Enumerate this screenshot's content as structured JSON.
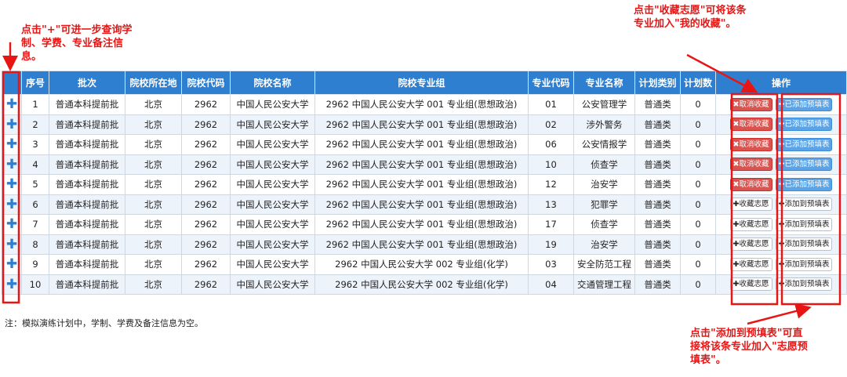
{
  "annotations": {
    "plus_note": "点击\"+\"可进一步查询学制、学费、专业备注信息。",
    "favorite_note": "点击\"收藏志愿\"可将该条专业加入\"我的收藏\"。",
    "preform_note": "点击\"添加到预填表\"可直接将该条专业加入\"志愿预填表\"。"
  },
  "table": {
    "headers": [
      "",
      "序号",
      "批次",
      "院校所在地",
      "院校代码",
      "院校名称",
      "院校专业组",
      "专业代码",
      "专业名称",
      "计划类别",
      "计划数",
      "操作"
    ],
    "rows": [
      {
        "plus": "✚",
        "no": "1",
        "batch": "普通本科提前批",
        "loc": "北京",
        "code": "2962",
        "school": "中国人民公安大学",
        "group": "2962 中国人民公安大学 001 专业组(思想政治)",
        "major_code": "01",
        "major": "公安管理学",
        "plan_type": "普通类",
        "plan_num": "0",
        "fav": "✖取消收藏",
        "pre": "✚已添加预填表",
        "fav_state": "on",
        "pre_state": "on"
      },
      {
        "plus": "✚",
        "no": "2",
        "batch": "普通本科提前批",
        "loc": "北京",
        "code": "2962",
        "school": "中国人民公安大学",
        "group": "2962 中国人民公安大学 001 专业组(思想政治)",
        "major_code": "02",
        "major": "涉外警务",
        "plan_type": "普通类",
        "plan_num": "0",
        "fav": "✖取消收藏",
        "pre": "✚已添加预填表",
        "fav_state": "on",
        "pre_state": "on"
      },
      {
        "plus": "✚",
        "no": "3",
        "batch": "普通本科提前批",
        "loc": "北京",
        "code": "2962",
        "school": "中国人民公安大学",
        "group": "2962 中国人民公安大学 001 专业组(思想政治)",
        "major_code": "06",
        "major": "公安情报学",
        "plan_type": "普通类",
        "plan_num": "0",
        "fav": "✖取消收藏",
        "pre": "✚已添加预填表",
        "fav_state": "on",
        "pre_state": "on"
      },
      {
        "plus": "✚",
        "no": "4",
        "batch": "普通本科提前批",
        "loc": "北京",
        "code": "2962",
        "school": "中国人民公安大学",
        "group": "2962 中国人民公安大学 001 专业组(思想政治)",
        "major_code": "10",
        "major": "侦查学",
        "plan_type": "普通类",
        "plan_num": "0",
        "fav": "✖取消收藏",
        "pre": "✚已添加预填表",
        "fav_state": "on",
        "pre_state": "on"
      },
      {
        "plus": "✚",
        "no": "5",
        "batch": "普通本科提前批",
        "loc": "北京",
        "code": "2962",
        "school": "中国人民公安大学",
        "group": "2962 中国人民公安大学 001 专业组(思想政治)",
        "major_code": "12",
        "major": "治安学",
        "plan_type": "普通类",
        "plan_num": "0",
        "fav": "✖取消收藏",
        "pre": "✚已添加预填表",
        "fav_state": "on",
        "pre_state": "on"
      },
      {
        "plus": "✚",
        "no": "6",
        "batch": "普通本科提前批",
        "loc": "北京",
        "code": "2962",
        "school": "中国人民公安大学",
        "group": "2962 中国人民公安大学 001 专业组(思想政治)",
        "major_code": "13",
        "major": "犯罪学",
        "plan_type": "普通类",
        "plan_num": "0",
        "fav": "✚收藏志愿",
        "pre": "✚添加到预填表",
        "fav_state": "off",
        "pre_state": "off"
      },
      {
        "plus": "✚",
        "no": "7",
        "batch": "普通本科提前批",
        "loc": "北京",
        "code": "2962",
        "school": "中国人民公安大学",
        "group": "2962 中国人民公安大学 001 专业组(思想政治)",
        "major_code": "17",
        "major": "侦查学",
        "plan_type": "普通类",
        "plan_num": "0",
        "fav": "✚收藏志愿",
        "pre": "✚添加到预填表",
        "fav_state": "off",
        "pre_state": "off"
      },
      {
        "plus": "✚",
        "no": "8",
        "batch": "普通本科提前批",
        "loc": "北京",
        "code": "2962",
        "school": "中国人民公安大学",
        "group": "2962 中国人民公安大学 001 专业组(思想政治)",
        "major_code": "19",
        "major": "治安学",
        "plan_type": "普通类",
        "plan_num": "0",
        "fav": "✚收藏志愿",
        "pre": "✚添加到预填表",
        "fav_state": "off",
        "pre_state": "off"
      },
      {
        "plus": "✚",
        "no": "9",
        "batch": "普通本科提前批",
        "loc": "北京",
        "code": "2962",
        "school": "中国人民公安大学",
        "group": "2962 中国人民公安大学 002 专业组(化学)",
        "major_code": "03",
        "major": "安全防范工程",
        "plan_type": "普通类",
        "plan_num": "0",
        "fav": "✚收藏志愿",
        "pre": "✚添加到预填表",
        "fav_state": "off",
        "pre_state": "off"
      },
      {
        "plus": "✚",
        "no": "10",
        "batch": "普通本科提前批",
        "loc": "北京",
        "code": "2962",
        "school": "中国人民公安大学",
        "group": "2962 中国人民公安大学 002 专业组(化学)",
        "major_code": "04",
        "major": "交通管理工程",
        "plan_type": "普通类",
        "plan_num": "0",
        "fav": "✚收藏志愿",
        "pre": "✚添加到预填表",
        "fav_state": "off",
        "pre_state": "off"
      }
    ]
  },
  "footnote": "注：模拟演练计划中，学制、学费及备注信息为空。",
  "colors": {
    "header_bg": "#2f7fd0",
    "annotation_red": "#e81515",
    "btn_red": "#d9534f",
    "btn_blue": "#5aa3e6",
    "row_alt": "#edf3fb"
  }
}
